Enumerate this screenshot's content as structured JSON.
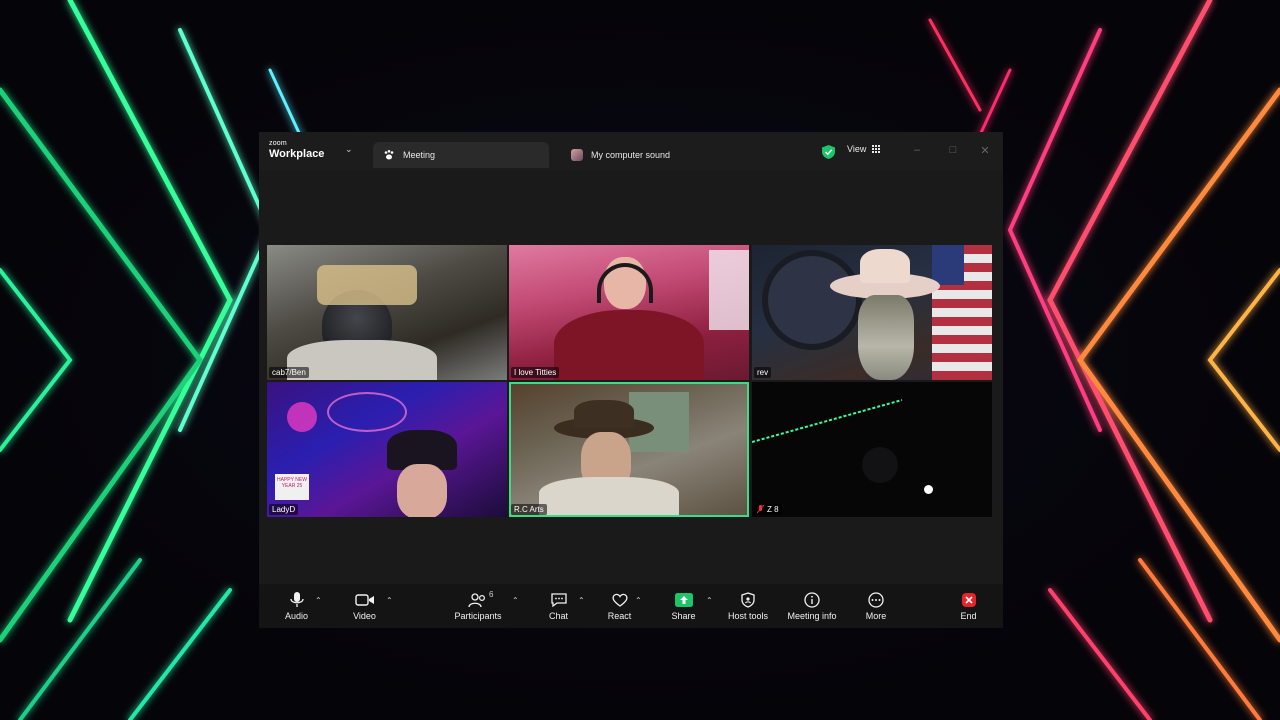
{
  "app": {
    "logo_small": "zoom",
    "logo_big": "Workplace",
    "tabs": [
      {
        "label": "Meeting",
        "icon": "paw-icon"
      },
      {
        "label": "My computer sound",
        "icon": "sound-app-icon"
      }
    ],
    "view_label": "View",
    "accent_color": "#3ddc84"
  },
  "participants": [
    {
      "name": "cab7/Ben",
      "active": false
    },
    {
      "name": "I love Titties",
      "active": false
    },
    {
      "name": "rev",
      "active": false
    },
    {
      "name": "LadyD",
      "active": false
    },
    {
      "name": "R.C Arts",
      "active": true
    },
    {
      "name": "Z 8",
      "active": false,
      "muted": true
    }
  ],
  "tile_text": {
    "happy_new_year": "HAPPY NEW YEAR 25"
  },
  "toolbar": {
    "audio": "Audio",
    "video": "Video",
    "participants": "Participants",
    "participant_count": "6",
    "chat": "Chat",
    "react": "React",
    "share": "Share",
    "host_tools": "Host tools",
    "meeting_info": "Meeting info",
    "more": "More",
    "end": "End"
  }
}
